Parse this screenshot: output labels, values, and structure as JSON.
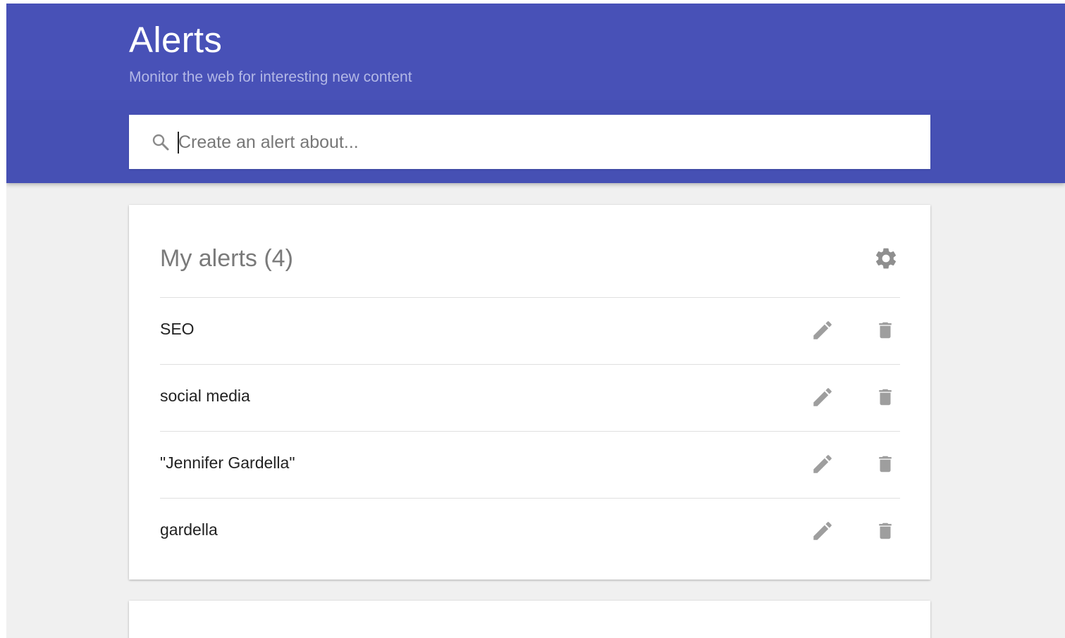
{
  "header": {
    "title": "Alerts",
    "subtitle": "Monitor the web for interesting new content"
  },
  "search": {
    "placeholder": "Create an alert about...",
    "value": "",
    "icon": "search-icon"
  },
  "alerts_card": {
    "heading": "My alerts (4)",
    "settings_icon": "gear-icon",
    "alerts": [
      {
        "name": "SEO",
        "edit_icon": "pencil-icon",
        "delete_icon": "trash-icon"
      },
      {
        "name": "social media",
        "edit_icon": "pencil-icon",
        "delete_icon": "trash-icon"
      },
      {
        "name": "\"Jennifer Gardella\"",
        "edit_icon": "pencil-icon",
        "delete_icon": "trash-icon"
      },
      {
        "name": "gardella",
        "edit_icon": "pencil-icon",
        "delete_icon": "trash-icon"
      }
    ]
  },
  "colors": {
    "header_bg": "#4851b7",
    "page_bg": "#f0f0f0",
    "icon_gray": "#9e9e9e"
  }
}
